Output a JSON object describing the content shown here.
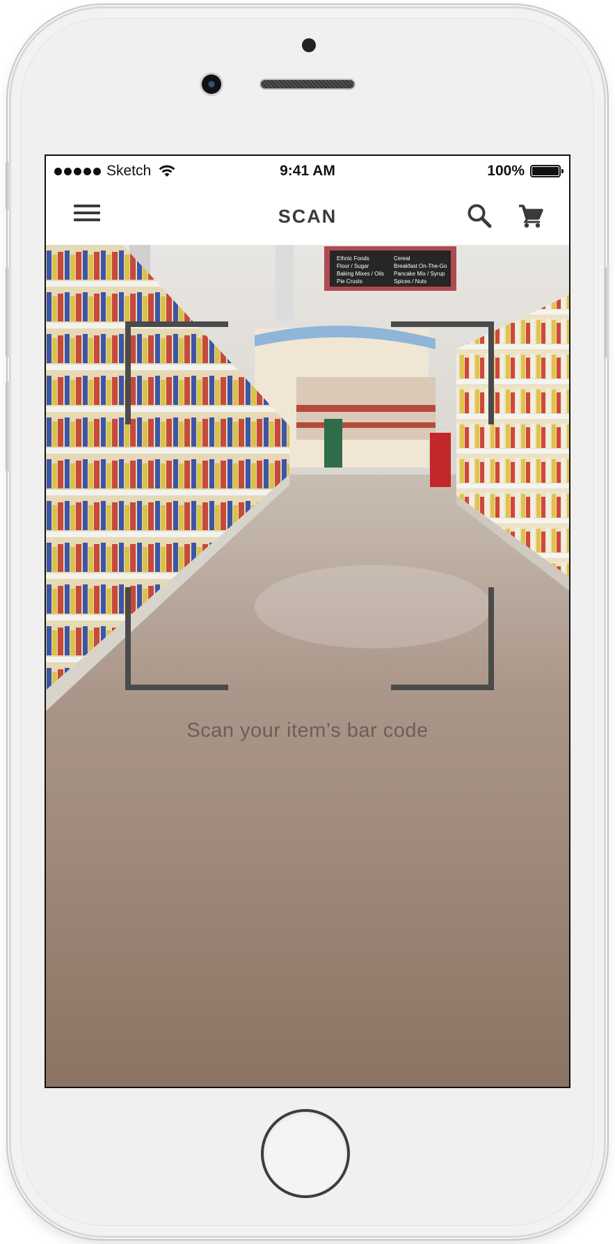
{
  "status_bar": {
    "carrier": "Sketch",
    "time": "9:41 AM",
    "battery": "100%",
    "icons": [
      "signal-dots",
      "wifi-icon",
      "battery-icon"
    ]
  },
  "nav": {
    "title": "SCAN",
    "icons": [
      "menu-icon",
      "search-icon",
      "cart-icon"
    ]
  },
  "scanner": {
    "instruction": "Scan your item’s bar code",
    "frame_color": "#4a4a4a"
  },
  "store_sign": {
    "left": [
      "Ethnic Foods",
      "Flour / Sugar",
      "Baking Mixes / Oils",
      "Pie Crusts"
    ],
    "right": [
      "Cereal",
      "Breakfast On-The-Go",
      "Pancake Mix / Syrup",
      "Spices / Nuts"
    ]
  },
  "colors": {
    "nav_text": "#3a3a3a",
    "floor": "#9a8474",
    "instruction_text": "#6a6058"
  }
}
